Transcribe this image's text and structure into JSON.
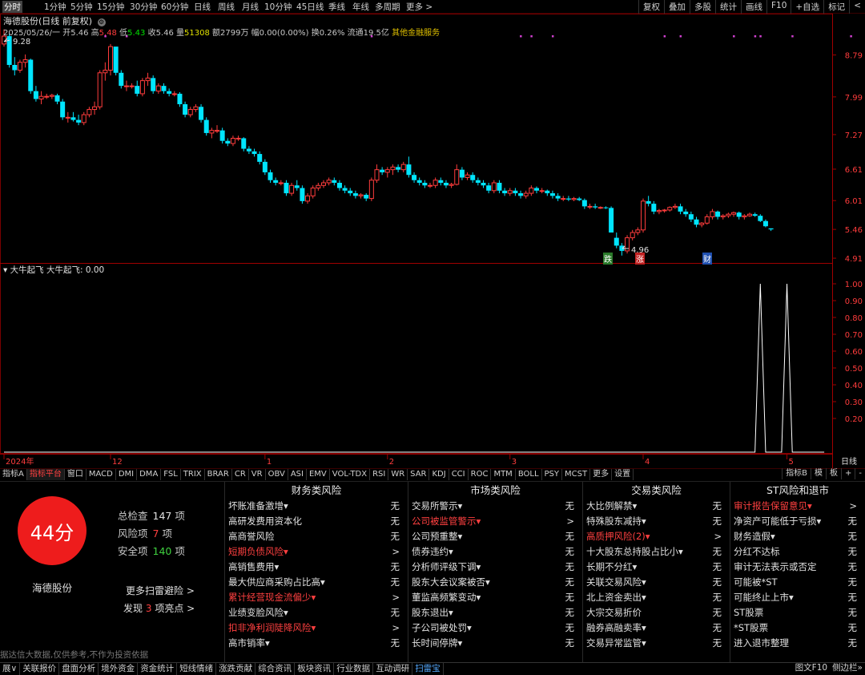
{
  "toolbar": {
    "timeframes": [
      "分时",
      "1分钟",
      "5分钟",
      "15分钟",
      "30分钟",
      "60分钟",
      "日线",
      "周线",
      "月线",
      "10分钟",
      "45日线",
      "季线",
      "年线",
      "多周期",
      "更多 >"
    ],
    "active_index": 0,
    "right_tools": [
      "复权",
      "叠加",
      "多股",
      "统计",
      "画线",
      "F10",
      "+自选",
      "标记",
      "<"
    ]
  },
  "header": {
    "title": "海德股份(日线 前复权)",
    "date": "2025/05/26/一",
    "open_label": "开",
    "open": "5.46",
    "high_label": "高",
    "high": "5.48",
    "low_label": "低",
    "low": "5.43",
    "close_label": "收",
    "close": "5.46",
    "vol_label": "量",
    "vol": "51308",
    "amt_label": "额",
    "amt": "2799万",
    "chg_label": "幅",
    "chg": "0.00(0.00%)",
    "turn_label": "换",
    "turn": "0.26%",
    "float_label": "流通",
    "float": "19.5亿",
    "service": "其他金融服务",
    "max_label": "9.28",
    "min_label": "4.96",
    "event_markers": [
      "跌",
      "涨",
      "财"
    ]
  },
  "indicator": {
    "label": "大牛起飞 大牛起飞: 0.00"
  },
  "colors": {
    "up": "#ff3c3c",
    "down": "#00e5ff",
    "grid": "#7a0000",
    "axis": "#ff3c3c",
    "accent": "#ee1c1c"
  },
  "chart_data": [
    {
      "type": "candlestick",
      "title": "海德股份(日线 前复权)",
      "y_ticks": [
        8.79,
        7.99,
        7.27,
        6.61,
        6.01,
        5.46,
        4.91
      ],
      "ylim": [
        4.85,
        9.35
      ],
      "x_labels": [
        "2024年",
        "12",
        "1",
        "2",
        "3",
        "4",
        "5"
      ],
      "x_label_idx": [
        0,
        20,
        49,
        72,
        95,
        120,
        147
      ],
      "candles": [
        [
          9.0,
          9.28,
          8.95,
          9.15
        ],
        [
          9.15,
          9.2,
          8.55,
          8.6
        ],
        [
          8.6,
          8.75,
          8.4,
          8.5
        ],
        [
          8.5,
          8.7,
          8.45,
          8.65
        ],
        [
          8.65,
          8.8,
          8.55,
          8.7
        ],
        [
          8.7,
          8.72,
          8.05,
          8.1
        ],
        [
          8.1,
          8.2,
          7.9,
          7.95
        ],
        [
          7.95,
          8.1,
          7.85,
          8.0
        ],
        [
          8.0,
          8.05,
          7.95,
          8.0
        ],
        [
          8.0,
          8.05,
          7.95,
          8.02
        ],
        [
          8.02,
          8.05,
          7.85,
          7.9
        ],
        [
          7.9,
          7.95,
          7.55,
          7.6
        ],
        [
          7.6,
          7.7,
          7.5,
          7.6
        ],
        [
          7.6,
          7.7,
          7.52,
          7.55
        ],
        [
          7.55,
          7.65,
          7.45,
          7.5
        ],
        [
          7.5,
          7.7,
          7.45,
          7.65
        ],
        [
          7.65,
          7.8,
          7.6,
          7.75
        ],
        [
          7.75,
          7.9,
          7.65,
          7.8
        ],
        [
          7.8,
          8.5,
          7.75,
          8.45
        ],
        [
          8.45,
          8.65,
          8.3,
          8.5
        ],
        [
          8.5,
          9.0,
          8.4,
          8.95
        ],
        [
          8.95,
          8.9,
          8.4,
          8.45
        ],
        [
          8.45,
          8.5,
          8.15,
          8.2
        ],
        [
          8.2,
          8.3,
          8.1,
          8.2
        ],
        [
          8.2,
          8.25,
          8.15,
          8.2
        ],
        [
          8.2,
          8.3,
          8.0,
          8.05
        ],
        [
          8.05,
          8.35,
          8.0,
          8.3
        ],
        [
          8.3,
          8.45,
          8.2,
          8.35
        ],
        [
          8.35,
          8.4,
          8.05,
          8.1
        ],
        [
          8.1,
          8.25,
          8.05,
          8.2
        ],
        [
          8.2,
          8.25,
          8.05,
          8.1
        ],
        [
          8.1,
          8.15,
          8.0,
          8.05
        ],
        [
          8.05,
          8.1,
          8.0,
          8.05
        ],
        [
          8.05,
          8.08,
          7.8,
          7.85
        ],
        [
          7.85,
          7.9,
          7.6,
          7.65
        ],
        [
          7.65,
          7.8,
          7.6,
          7.75
        ],
        [
          7.75,
          7.85,
          7.7,
          7.8
        ],
        [
          7.8,
          7.85,
          7.5,
          7.55
        ],
        [
          7.55,
          7.6,
          7.25,
          7.3
        ],
        [
          7.3,
          7.4,
          7.2,
          7.35
        ],
        [
          7.35,
          7.45,
          7.3,
          7.35
        ],
        [
          7.35,
          7.4,
          7.1,
          7.15
        ],
        [
          7.15,
          7.2,
          7.05,
          7.1
        ],
        [
          7.1,
          7.25,
          7.05,
          7.2
        ],
        [
          7.2,
          7.25,
          7.15,
          7.2
        ],
        [
          7.2,
          7.22,
          6.95,
          7.0
        ],
        [
          7.0,
          7.05,
          6.9,
          6.95
        ],
        [
          6.95,
          7.0,
          6.85,
          6.9
        ],
        [
          6.9,
          6.95,
          6.7,
          6.75
        ],
        [
          6.75,
          6.8,
          6.5,
          6.55
        ],
        [
          6.55,
          6.6,
          6.35,
          6.4
        ],
        [
          6.4,
          6.45,
          6.3,
          6.35
        ],
        [
          6.35,
          6.4,
          6.3,
          6.35
        ],
        [
          6.35,
          6.4,
          6.1,
          6.15
        ],
        [
          6.15,
          6.35,
          6.1,
          6.3
        ],
        [
          6.3,
          6.4,
          6.2,
          6.25
        ],
        [
          6.25,
          6.3,
          5.95,
          6.0
        ],
        [
          6.0,
          6.15,
          5.95,
          6.1
        ],
        [
          6.1,
          6.3,
          6.05,
          6.25
        ],
        [
          6.25,
          6.35,
          6.2,
          6.3
        ],
        [
          6.3,
          6.4,
          6.25,
          6.35
        ],
        [
          6.35,
          6.45,
          6.3,
          6.4
        ],
        [
          6.4,
          6.45,
          6.3,
          6.35
        ],
        [
          6.35,
          6.4,
          6.2,
          6.25
        ],
        [
          6.25,
          6.3,
          6.15,
          6.2
        ],
        [
          6.2,
          6.25,
          6.1,
          6.15
        ],
        [
          6.15,
          6.2,
          6.05,
          6.1
        ],
        [
          6.1,
          6.15,
          6.05,
          6.12
        ],
        [
          6.12,
          6.15,
          6.0,
          6.05
        ],
        [
          6.05,
          6.45,
          6.0,
          6.4
        ],
        [
          6.4,
          6.7,
          6.35,
          6.6
        ],
        [
          6.6,
          6.65,
          6.5,
          6.55
        ],
        [
          6.55,
          6.65,
          6.45,
          6.6
        ],
        [
          6.6,
          6.7,
          6.5,
          6.65
        ],
        [
          6.65,
          6.7,
          6.55,
          6.6
        ],
        [
          6.6,
          6.75,
          6.55,
          6.7
        ],
        [
          6.7,
          6.85,
          6.45,
          6.5
        ],
        [
          6.5,
          6.55,
          6.35,
          6.4
        ],
        [
          6.4,
          6.45,
          6.3,
          6.35
        ],
        [
          6.35,
          6.4,
          6.25,
          6.3
        ],
        [
          6.3,
          6.35,
          6.25,
          6.3
        ],
        [
          6.3,
          6.45,
          6.25,
          6.4
        ],
        [
          6.4,
          6.45,
          6.3,
          6.35
        ],
        [
          6.35,
          6.4,
          6.25,
          6.3
        ],
        [
          6.3,
          6.35,
          6.25,
          6.32
        ],
        [
          6.32,
          6.7,
          6.3,
          6.6
        ],
        [
          6.6,
          6.65,
          6.4,
          6.45
        ],
        [
          6.45,
          6.55,
          6.4,
          6.5
        ],
        [
          6.5,
          6.55,
          6.35,
          6.4
        ],
        [
          6.4,
          6.45,
          6.3,
          6.35
        ],
        [
          6.35,
          6.4,
          6.25,
          6.3
        ],
        [
          6.3,
          6.35,
          6.15,
          6.2
        ],
        [
          6.2,
          6.4,
          6.15,
          6.35
        ],
        [
          6.35,
          6.4,
          6.15,
          6.2
        ],
        [
          6.2,
          6.25,
          6.1,
          6.15
        ],
        [
          6.15,
          6.25,
          6.1,
          6.2
        ],
        [
          6.2,
          6.25,
          6.1,
          6.15
        ],
        [
          6.15,
          6.2,
          6.05,
          6.1
        ],
        [
          6.1,
          6.2,
          6.05,
          6.15
        ],
        [
          6.15,
          6.3,
          6.1,
          6.25
        ],
        [
          6.25,
          6.28,
          6.15,
          6.2
        ],
        [
          6.2,
          6.25,
          6.15,
          6.2
        ],
        [
          6.2,
          6.22,
          6.1,
          6.15
        ],
        [
          6.15,
          6.2,
          6.05,
          6.1
        ],
        [
          6.1,
          6.15,
          6.0,
          6.05
        ],
        [
          6.05,
          6.1,
          6.0,
          6.05
        ],
        [
          6.05,
          6.1,
          6.0,
          6.03
        ],
        [
          6.03,
          6.08,
          6.0,
          6.05
        ],
        [
          6.05,
          6.08,
          6.0,
          6.02
        ],
        [
          6.02,
          6.05,
          5.85,
          5.9
        ],
        [
          5.9,
          5.95,
          5.85,
          5.9
        ],
        [
          5.9,
          5.95,
          5.85,
          5.88
        ],
        [
          5.88,
          5.9,
          5.85,
          5.88
        ],
        [
          5.88,
          5.9,
          5.85,
          5.87
        ],
        [
          5.87,
          5.9,
          5.55,
          5.4
        ],
        [
          5.3,
          5.4,
          5.1,
          5.15
        ],
        [
          5.15,
          5.2,
          4.96,
          5.05
        ],
        [
          5.05,
          5.35,
          5.0,
          5.3
        ],
        [
          5.3,
          5.45,
          5.25,
          5.4
        ],
        [
          5.4,
          5.5,
          5.35,
          5.45
        ],
        [
          5.45,
          6.05,
          5.4,
          6.0
        ],
        [
          6.0,
          6.1,
          5.9,
          5.95
        ],
        [
          5.95,
          6.0,
          5.75,
          5.8
        ],
        [
          5.8,
          5.85,
          5.75,
          5.82
        ],
        [
          5.82,
          5.85,
          5.78,
          5.83
        ],
        [
          5.83,
          5.9,
          5.8,
          5.88
        ],
        [
          5.88,
          5.95,
          5.85,
          5.9
        ],
        [
          5.9,
          5.95,
          5.75,
          5.8
        ],
        [
          5.8,
          5.85,
          5.7,
          5.75
        ],
        [
          5.75,
          5.8,
          5.6,
          5.65
        ],
        [
          5.65,
          5.7,
          5.5,
          5.55
        ],
        [
          5.55,
          5.6,
          5.5,
          5.58
        ],
        [
          5.58,
          5.75,
          5.55,
          5.7
        ],
        [
          5.7,
          5.85,
          5.65,
          5.8
        ],
        [
          5.8,
          5.82,
          5.65,
          5.7
        ],
        [
          5.7,
          5.75,
          5.65,
          5.72
        ],
        [
          5.72,
          5.78,
          5.68,
          5.75
        ],
        [
          5.75,
          5.8,
          5.7,
          5.78
        ],
        [
          5.78,
          5.8,
          5.65,
          5.7
        ],
        [
          5.7,
          5.75,
          5.65,
          5.72
        ],
        [
          5.72,
          5.78,
          5.7,
          5.75
        ],
        [
          5.75,
          5.78,
          5.7,
          5.72
        ],
        [
          5.72,
          5.75,
          5.6,
          5.62
        ],
        [
          5.62,
          5.65,
          5.5,
          5.52
        ],
        [
          5.48,
          5.48,
          5.43,
          5.46
        ]
      ]
    },
    {
      "type": "line",
      "title": "大牛起飞",
      "y_ticks": [
        1.0,
        0.9,
        0.8,
        0.7,
        0.6,
        0.5,
        0.4,
        0.3,
        0.2
      ],
      "ylim": [
        0,
        1.0
      ],
      "spikes_at_index": [
        142,
        147
      ],
      "last_index": 154
    }
  ],
  "tabs": [
    "指标A",
    "指标平台",
    "窗口",
    "MACD",
    "DMI",
    "DMA",
    "FSL",
    "TRIX",
    "BRAR",
    "CR",
    "VR",
    "OBV",
    "ASI",
    "EMV",
    "VOL-TDX",
    "RSI",
    "WR",
    "SAR",
    "KDJ",
    "CCI",
    "ROC",
    "MTM",
    "BOLL",
    "PSY",
    "MCST",
    "更多",
    "设置"
  ],
  "tabs_active": 1,
  "tabs_right": [
    "指标B",
    "模",
    "板",
    "+",
    "-",
    "日线"
  ],
  "risk": {
    "score": "44分",
    "stock": "海德股份",
    "total_label": "总检查",
    "total": "147",
    "total_unit": "项",
    "risk_label": "风险项",
    "risk_count": "7",
    "risk_unit": "项",
    "safe_label": "安全项",
    "safe": "140",
    "safe_unit": "项",
    "more_link": "更多扫雷避险 >",
    "found_prefix": "发现",
    "found_count": "3",
    "found_suffix": "项亮点 >",
    "disclaimer": "据达信大数据,仅供参考,不作为投资依据",
    "columns": [
      {
        "title": "财务类风险",
        "items": [
          {
            "label": "坏账准备激增▾",
            "value": "无",
            "red": false
          },
          {
            "label": "高研发费用资本化",
            "value": "无",
            "red": false
          },
          {
            "label": "高商誉风险",
            "value": "无",
            "red": false
          },
          {
            "label": "短期负债风险▾",
            "value": ">",
            "red": true
          },
          {
            "label": "高销售费用▾",
            "value": "无",
            "red": false
          },
          {
            "label": "最大供应商采购占比高▾",
            "value": "无",
            "red": false
          },
          {
            "label": "累计经营现金流偏少▾",
            "value": ">",
            "red": true
          },
          {
            "label": "业绩变脸风险▾",
            "value": "无",
            "red": false
          },
          {
            "label": "扣非净利润陡降风险▾",
            "value": ">",
            "red": true
          },
          {
            "label": "高市销率▾",
            "value": "无",
            "red": false
          }
        ]
      },
      {
        "title": "市场类风险",
        "items": [
          {
            "label": "交易所警示▾",
            "value": "无",
            "red": false
          },
          {
            "label": "公司被监管警示▾",
            "value": ">",
            "red": true
          },
          {
            "label": "公司预重整▾",
            "value": "无",
            "red": false
          },
          {
            "label": "债券违约▾",
            "value": "无",
            "red": false
          },
          {
            "label": "分析师评级下调▾",
            "value": "无",
            "red": false
          },
          {
            "label": "股东大会议案被否▾",
            "value": "无",
            "red": false
          },
          {
            "label": "董监高频繁变动▾",
            "value": "无",
            "red": false
          },
          {
            "label": "股东退出▾",
            "value": "无",
            "red": false
          },
          {
            "label": "子公司被处罚▾",
            "value": "无",
            "red": false
          },
          {
            "label": "长时间停牌▾",
            "value": "无",
            "red": false
          }
        ]
      },
      {
        "title": "交易类风险",
        "items": [
          {
            "label": "大比例解禁▾",
            "value": "无",
            "red": false
          },
          {
            "label": "特殊股东减持▾",
            "value": "无",
            "red": false
          },
          {
            "label": "高质押风险(2)▾",
            "value": ">",
            "red": true
          },
          {
            "label": "十大股东总持股占比小▾",
            "value": "无",
            "red": false
          },
          {
            "label": "长期不分红▾",
            "value": "无",
            "red": false
          },
          {
            "label": "关联交易风险▾",
            "value": "无",
            "red": false
          },
          {
            "label": "北上资金卖出▾",
            "value": "无",
            "red": false
          },
          {
            "label": "大宗交易折价",
            "value": "无",
            "red": false
          },
          {
            "label": "融券高融卖率▾",
            "value": "无",
            "red": false
          },
          {
            "label": "交易异常监管▾",
            "value": "无",
            "red": false
          }
        ]
      },
      {
        "title": "ST风险和退市",
        "items": [
          {
            "label": "审计报告保留意见▾",
            "value": ">",
            "red": true
          },
          {
            "label": "净资产可能低于亏损▾",
            "value": "无",
            "red": false
          },
          {
            "label": "财务造假▾",
            "value": "无",
            "red": false
          },
          {
            "label": "分红不达标",
            "value": "无",
            "red": false
          },
          {
            "label": "审计无法表示或否定",
            "value": "无",
            "red": false
          },
          {
            "label": "可能被*ST",
            "value": "无",
            "red": false
          },
          {
            "label": "可能终止上市▾",
            "value": "无",
            "red": false
          },
          {
            "label": "ST股票",
            "value": "无",
            "red": false
          },
          {
            "label": "*ST股票",
            "value": "无",
            "red": false
          },
          {
            "label": "进入退市整理",
            "value": "无",
            "red": false
          }
        ]
      }
    ]
  },
  "statusbar": [
    "展∨",
    "关联报价",
    "盘面分析",
    "境外资金",
    "资金统计",
    "短线情绪",
    "涨跌贡献",
    "综合资讯",
    "板块资讯",
    "行业数据",
    "互动调研",
    "扫雷宝"
  ],
  "statusbar_active": 11,
  "statusbar_right": [
    "图文F10",
    "侧边栏»"
  ]
}
